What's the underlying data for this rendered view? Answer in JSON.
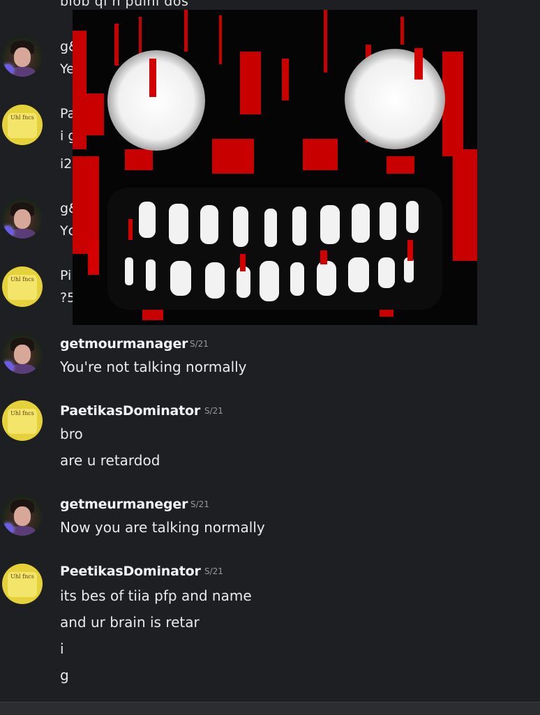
{
  "top_fragment": "blob qi n pulni dos",
  "partial_messages": [
    {
      "avatar": "dark",
      "name_fragment": "g&",
      "text_fragment": "Ye"
    },
    {
      "avatar": "yellow",
      "name_fragment": "Pa",
      "text_fragments": [
        "i g",
        "i2"
      ]
    },
    {
      "avatar": "dark",
      "name_fragment": "g&",
      "text_fragment": "Yc"
    },
    {
      "avatar": "yellow",
      "name_fragment": "Pi",
      "text_fragment": "?5"
    }
  ],
  "messages": [
    {
      "username": "getmourmanager",
      "timestamp": "S/21",
      "lines": [
        "You're not talking normally"
      ],
      "avatar": "dark"
    },
    {
      "username": "PaetikasDominator",
      "timestamp": "S/21",
      "lines": [
        "bro",
        "are u retardod"
      ],
      "avatar": "yellow"
    },
    {
      "username": "getmeurmaneger",
      "timestamp": "S/21",
      "lines": [
        "Now you are talking normally"
      ],
      "avatar": "dark"
    },
    {
      "username": "PeetikasDominator",
      "timestamp": "S/21",
      "lines": [
        "its bes of tiia pfp and name",
        "and ur brain is retar",
        "i",
        "g"
      ],
      "avatar": "yellow"
    }
  ],
  "avatar_labels": {
    "yellow": "Uhl fncs"
  },
  "overlay": {
    "description_icon": "scary-face-image"
  },
  "colors": {
    "background": "#1e1f22",
    "text": "#dbdee1",
    "username": "#f2f3f5",
    "timestamp": "#949ba4",
    "red": "#d40000"
  }
}
